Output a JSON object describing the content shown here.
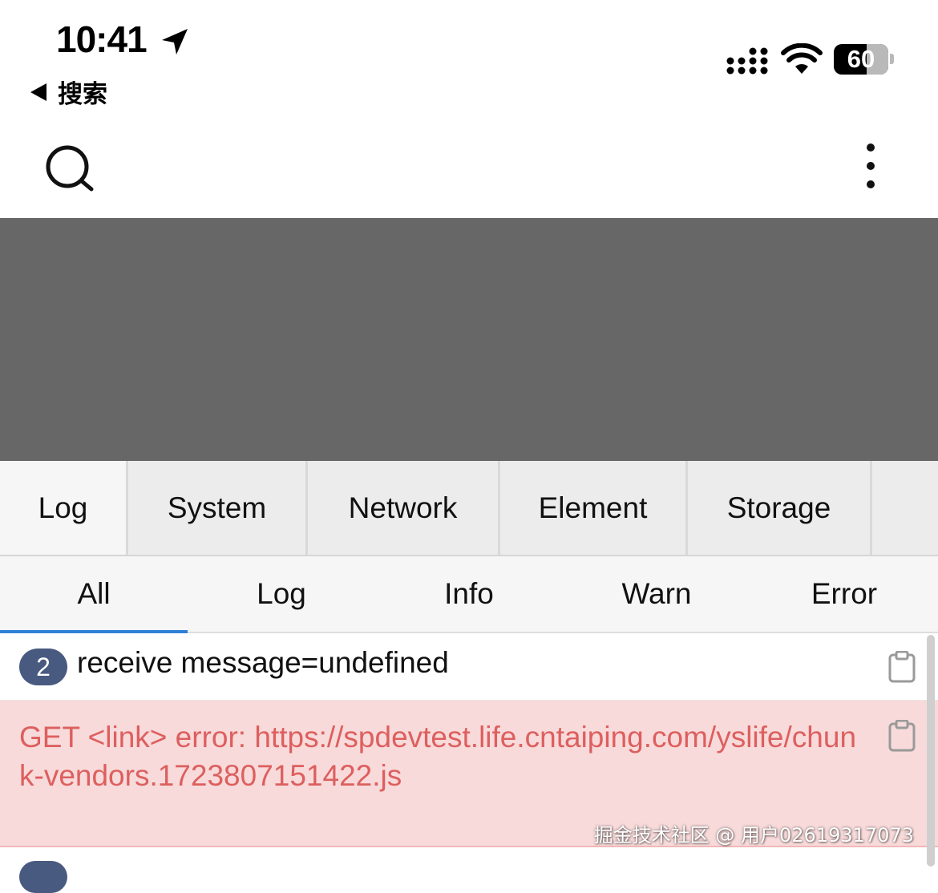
{
  "status_bar": {
    "time": "10:41",
    "back_label": "搜索",
    "battery_percent": "60",
    "battery_level": 0.6
  },
  "nav": {
    "search_icon": "search-icon",
    "more_icon": "more-vertical-icon"
  },
  "main_tabs": [
    "Log",
    "System",
    "Network",
    "Element",
    "Storage"
  ],
  "sub_tabs": [
    "All",
    "Log",
    "Info",
    "Warn",
    "Error"
  ],
  "log_entries": [
    {
      "count": "2",
      "message": "receive message=undefined",
      "level": "log"
    },
    {
      "message": "GET <link> error: https://spdevtest.life.cntaiping.com/yslife/chunk-vendors.1723807151422.js",
      "level": "error"
    }
  ],
  "watermark": "掘金技术社区 @ 用户02619317073",
  "colors": {
    "preview_bg": "#676767",
    "tab_active_underline": "#2f7fd6",
    "error_bg": "#f8dada",
    "error_text": "#dd5f5f",
    "badge_bg": "#495a80"
  }
}
